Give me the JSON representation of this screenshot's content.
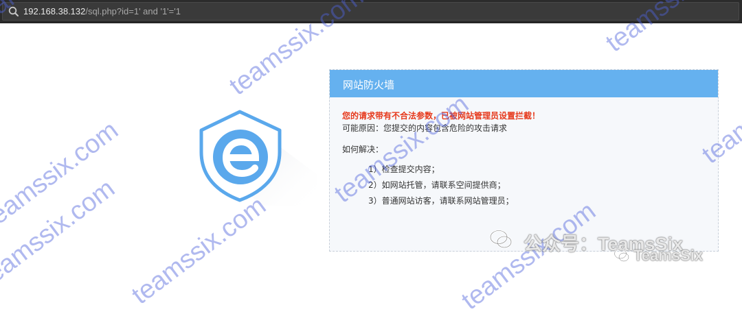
{
  "browser": {
    "url_host": "192.168.38.132",
    "url_rest": "/sql.php?id=1' and '1'='1"
  },
  "firewall": {
    "title": "网站防火墙",
    "warning": "您的请求带有不合法参数，已被网站管理员设置拦截！",
    "reason": "可能原因：您提交的内容包含危险的攻击请求",
    "howto": "如何解决：",
    "steps": [
      "1）检查提交内容；",
      "2）如网站托管，请联系空间提供商；",
      "3）普通网站访客，请联系网站管理员；"
    ]
  },
  "watermark": {
    "text": "teamssix.com",
    "brand_line1": "公众号：TeamsSix",
    "brand_line2": "TeamsSix"
  },
  "colors": {
    "header": "#65b1ef",
    "warning": "#e63a1d",
    "shield": "#5aa8ec",
    "watermark": "#5064dc"
  }
}
